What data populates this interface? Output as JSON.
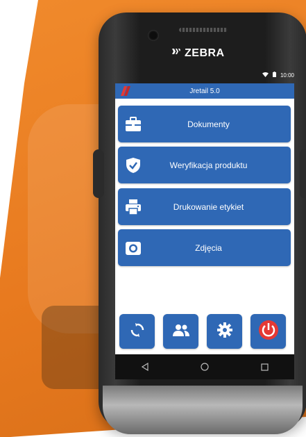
{
  "device": {
    "brand": "ZEBRA"
  },
  "status_bar": {
    "time": "10:00"
  },
  "app": {
    "title": "Jretail 5.0",
    "accent_color": "#2f68b5",
    "power_color": "#e53935"
  },
  "menu": [
    {
      "label": "Dokumenty",
      "icon": "briefcase-icon"
    },
    {
      "label": "Weryfikacja produktu",
      "icon": "shield-check-icon"
    },
    {
      "label": "Drukowanie etykiet",
      "icon": "printer-icon"
    },
    {
      "label": "Zdjęcia",
      "icon": "camera-icon"
    }
  ],
  "bottom_actions": [
    {
      "icon": "sync-icon"
    },
    {
      "icon": "users-icon"
    },
    {
      "icon": "settings-icon"
    },
    {
      "icon": "power-icon"
    }
  ],
  "navigation": [
    {
      "icon": "back-icon"
    },
    {
      "icon": "home-icon"
    },
    {
      "icon": "recents-icon"
    }
  ]
}
